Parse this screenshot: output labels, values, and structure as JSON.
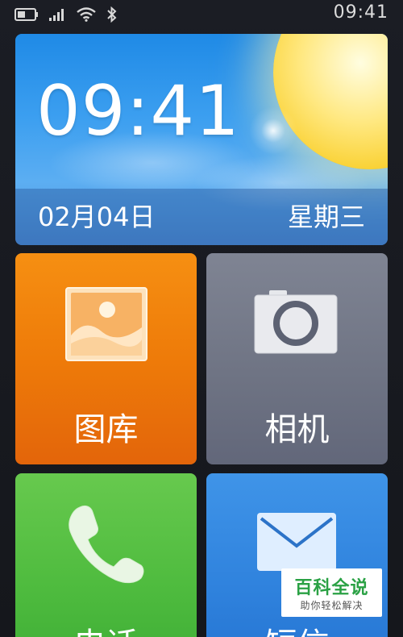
{
  "status_bar": {
    "time": "09:41",
    "icons": [
      "battery-icon",
      "signal-icon",
      "wifi-icon",
      "bluetooth-icon"
    ]
  },
  "clock_widget": {
    "time": "09:41",
    "date": "02月04日",
    "weekday": "星期三",
    "weather_icon": "sun-icon"
  },
  "apps": [
    {
      "label": "图库",
      "icon": "gallery-icon",
      "color": "#F08010"
    },
    {
      "label": "相机",
      "icon": "camera-icon",
      "color": "#737888"
    },
    {
      "label": "电话",
      "icon": "phone-icon",
      "color": "#55C044"
    },
    {
      "label": "短信",
      "icon": "message-icon",
      "color": "#3388E0"
    }
  ],
  "watermark": {
    "title": "百科全说",
    "subtitle": "助你轻松解决"
  }
}
